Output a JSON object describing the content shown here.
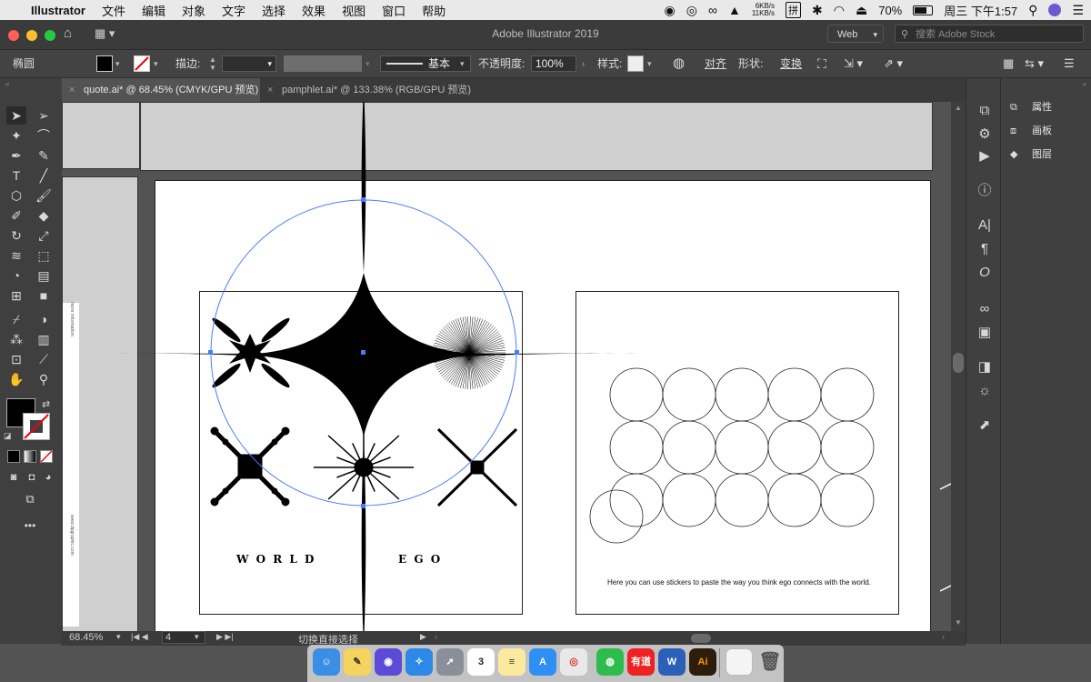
{
  "menubar": {
    "app_name": "Illustrator",
    "items": [
      "文件",
      "编辑",
      "对象",
      "文字",
      "选择",
      "效果",
      "视图",
      "窗口",
      "帮助"
    ],
    "net_up": "6KB/s",
    "net_down": "11KB/s",
    "input_method": "拼",
    "battery": "70%",
    "clock": "周三 下午1:57"
  },
  "window": {
    "title": "Adobe Illustrator 2019",
    "workspace": "Web",
    "stock_placeholder": "搜索 Adobe Stock"
  },
  "control": {
    "object_type": "椭圆",
    "stroke_label": "描边:",
    "profile": "基本",
    "opacity_label": "不透明度:",
    "opacity_value": "100%",
    "style_label": "样式:",
    "align": "对齐",
    "shape_label": "形状:",
    "transform": "变换",
    "fill_color": "#000000"
  },
  "tabs": [
    {
      "label": "quote.ai* @ 68.45% (CMYK/GPU 预览)"
    },
    {
      "label": "pamphlet.ai* @ 133.38% (RGB/GPU 预览)"
    }
  ],
  "artboard": {
    "world_text": "W O R L D",
    "ego_text": "E G O",
    "caption": "Here you can use stickers to paste the way you think ego connects with the world.",
    "side_text_top": "more information: ",
    "side_text_bottom": "www.dpgraphic.com"
  },
  "status": {
    "zoom": "68.45%",
    "artboard_num": "4",
    "tool_hint": "切换直接选择"
  },
  "panels": {
    "properties": "属性",
    "artboards": "画板",
    "layers": "图层"
  },
  "dock": {
    "calendar_day": "3",
    "youdao": "有道",
    "word": "W",
    "ai": "Ai"
  }
}
